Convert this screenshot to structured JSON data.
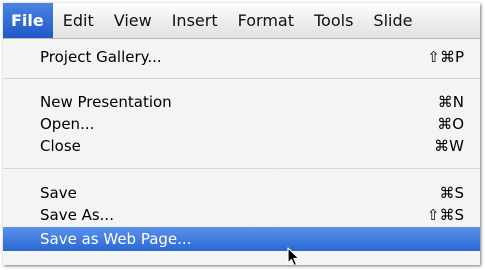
{
  "menubar": {
    "items": [
      {
        "label": "File"
      },
      {
        "label": "Edit"
      },
      {
        "label": "View"
      },
      {
        "label": "Insert"
      },
      {
        "label": "Format"
      },
      {
        "label": "Tools"
      },
      {
        "label": "Slide"
      }
    ],
    "active_index": 0
  },
  "file_menu": {
    "items": [
      {
        "label": "Project Gallery...",
        "shortcut": "⇧⌘P"
      },
      {
        "label": "New Presentation",
        "shortcut": "⌘N"
      },
      {
        "label": "Open...",
        "shortcut": "⌘O"
      },
      {
        "label": "Close",
        "shortcut": "⌘W"
      },
      {
        "label": "Save",
        "shortcut": "⌘S"
      },
      {
        "label": "Save As...",
        "shortcut": "⇧⌘S"
      },
      {
        "label": "Save as Web Page...",
        "shortcut": ""
      }
    ],
    "highlighted_index": 6
  },
  "colors": {
    "menu_highlight": "#2a67d3",
    "menu_background": "#f4f4f4"
  },
  "icons": {
    "cursor": "arrow-cursor-icon"
  }
}
